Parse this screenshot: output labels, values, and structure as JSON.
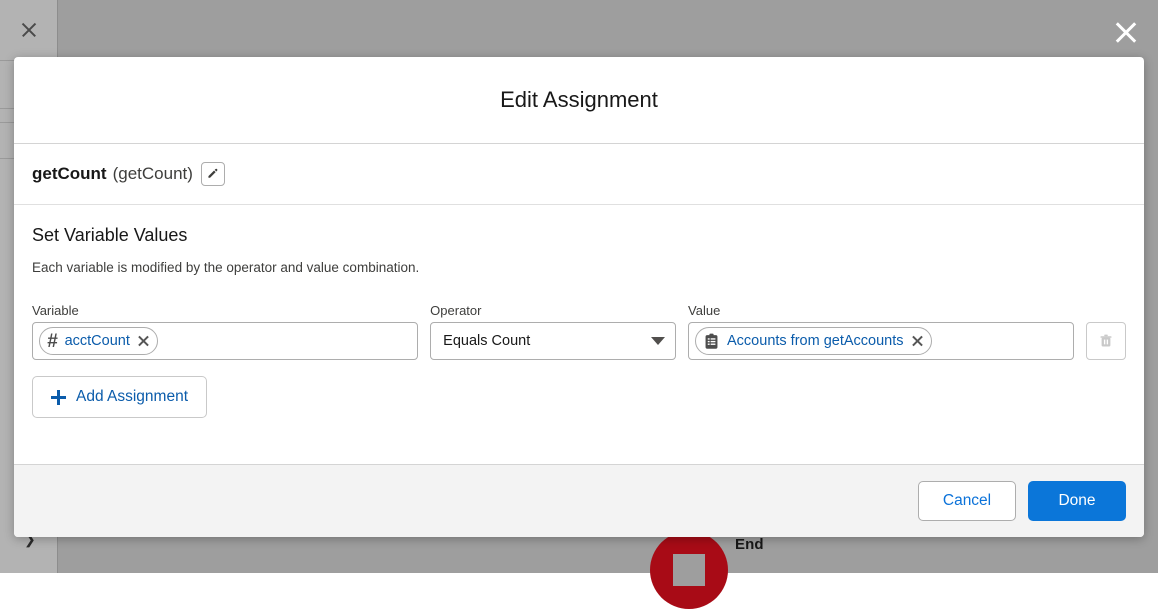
{
  "background": {
    "close_icon": "close-icon",
    "end_node_label": "End",
    "end_node_color": "#a80b16"
  },
  "global_close": {
    "icon": "close-icon"
  },
  "modal": {
    "title": "Edit Assignment",
    "element": {
      "name": "getCount",
      "api_name": "(getCount)",
      "edit_icon": "pencil-icon"
    },
    "section": {
      "title": "Set Variable Values",
      "help": "Each variable is modified by the operator and value combination."
    },
    "row": {
      "variable_label": "Variable",
      "variable_pill": {
        "icon": "number-hash-icon",
        "text": "acctCount",
        "remove_icon": "close-icon"
      },
      "operator_label": "Operator",
      "operator_value": "Equals Count",
      "operator_caret_icon": "chevron-down-icon",
      "value_label": "Value",
      "value_pill": {
        "icon": "record-collection-icon",
        "text": "Accounts from getAccounts",
        "remove_icon": "close-icon"
      },
      "delete_icon": "trash-icon"
    },
    "add_assignment_label": "Add Assignment",
    "footer": {
      "cancel_label": "Cancel",
      "done_label": "Done"
    }
  },
  "colors": {
    "accent_blue": "#0b76d9",
    "link_blue": "#0b5cab",
    "end_red": "#a80b16",
    "footer_gray": "#f3f3f3"
  }
}
